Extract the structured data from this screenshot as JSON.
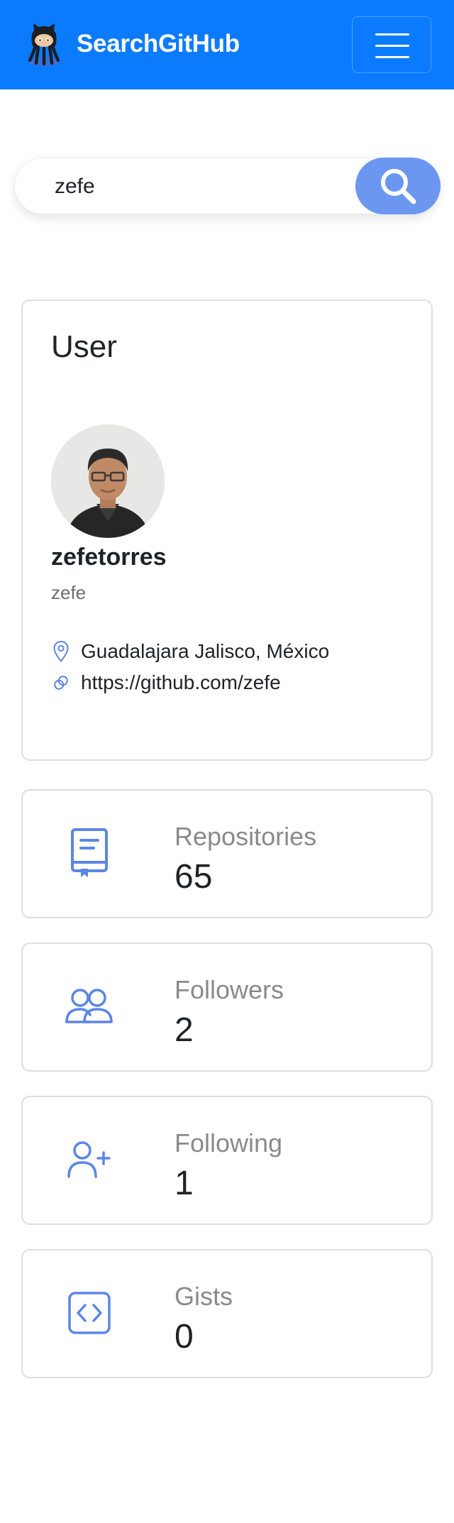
{
  "navbar": {
    "brand": "SearchGitHub",
    "logo_icon": "octocat-icon",
    "menu_icon": "hamburger-menu-icon",
    "background": "#0a7bff"
  },
  "search": {
    "value": "zefe",
    "button_icon": "search-icon",
    "button_color": "#6b97f0"
  },
  "user_card": {
    "title": "User",
    "login": "zefetorres",
    "handle": "zefe",
    "location": "Guadalajara Jalisco, México",
    "location_icon": "map-pin-icon",
    "url": "https://github.com/zefe",
    "url_icon": "link-icon"
  },
  "stats": [
    {
      "label": "Repositories",
      "value": "65",
      "icon": "book-icon"
    },
    {
      "label": "Followers",
      "value": "2",
      "icon": "users-icon"
    },
    {
      "label": "Following",
      "value": "1",
      "icon": "user-plus-icon"
    },
    {
      "label": "Gists",
      "value": "0",
      "icon": "code-icon"
    }
  ],
  "accent_color": "#5b86e5"
}
